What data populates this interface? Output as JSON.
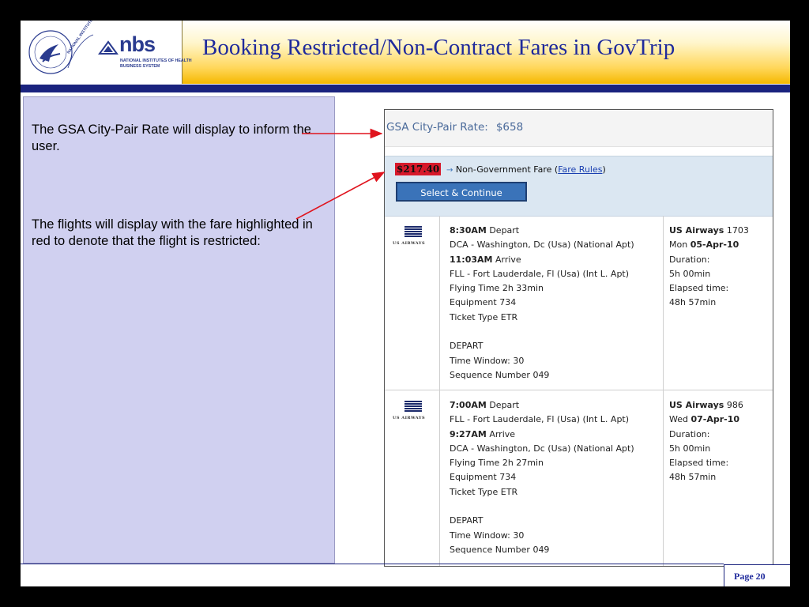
{
  "header": {
    "title": "Booking Restricted/Non-Contract Fares in GovTrip",
    "logo_mark": "nbs",
    "logo_line1": "NATIONAL INSTITUTES OF HEALTH",
    "logo_line2": "BUSINESS SYSTEM",
    "seal_text": "NATIONAL INSTITUTES OF HEALTH"
  },
  "left_panel": {
    "paragraph1": "The GSA City-Pair Rate will display to inform the user.",
    "paragraph2": "The flights will display with the fare highlighted in red to denote that the flight is restricted:"
  },
  "screenshot": {
    "gsa_label": "GSA City-Pair Rate:",
    "gsa_amount": "$658",
    "price": "$217.40",
    "fare_arrow": "→",
    "fare_text": "Non-Government Fare (",
    "fare_link": "Fare Rules",
    "fare_close": ")",
    "select_button": "Select & Continue",
    "flights": [
      {
        "airline_small": "US AIRWAYS",
        "depart_time": "8:30AM",
        "depart_word": " Depart",
        "from": "DCA - Washington, Dc (Usa) (National Apt)",
        "arrive_time": "11:03AM",
        "arrive_word": " Arrive",
        "to": "FLL - Fort Lauderdale, Fl (Usa) (Int L. Apt)",
        "flying_time": "Flying Time 2h 33min",
        "equipment": "Equipment 734",
        "ticket_type": "Ticket Type ETR",
        "direction": "DEPART",
        "time_window": "Time Window: 30",
        "sequence": "Sequence Number 049",
        "airline": "US Airways",
        "flight_no": " 1703",
        "day": "Mon ",
        "date": "05-Apr-10",
        "duration_label": "Duration:",
        "duration": "5h 00min",
        "elapsed_label": "Elapsed time:",
        "elapsed": "48h 57min"
      },
      {
        "airline_small": "US AIRWAYS",
        "depart_time": "7:00AM",
        "depart_word": " Depart",
        "from": "FLL - Fort Lauderdale, Fl (Usa) (Int L. Apt)",
        "arrive_time": "9:27AM",
        "arrive_word": " Arrive",
        "to": "DCA - Washington, Dc (Usa) (National Apt)",
        "flying_time": "Flying Time 2h 27min",
        "equipment": "Equipment 734",
        "ticket_type": "Ticket Type ETR",
        "direction": "DEPART",
        "time_window": "Time Window: 30",
        "sequence": "Sequence Number 049",
        "airline": "US Airways",
        "flight_no": " 986",
        "day": "Wed ",
        "date": "07-Apr-10",
        "duration_label": "Duration:",
        "duration": "5h 00min",
        "elapsed_label": "Elapsed time:",
        "elapsed": "48h 57min"
      }
    ]
  },
  "footer": {
    "page": "Page 20"
  },
  "colors": {
    "title": "#1f2a9c",
    "panel": "#d0d0f0",
    "arrow": "#e0141e",
    "price_highlight": "#d7192b",
    "button": "#3a73b9"
  }
}
